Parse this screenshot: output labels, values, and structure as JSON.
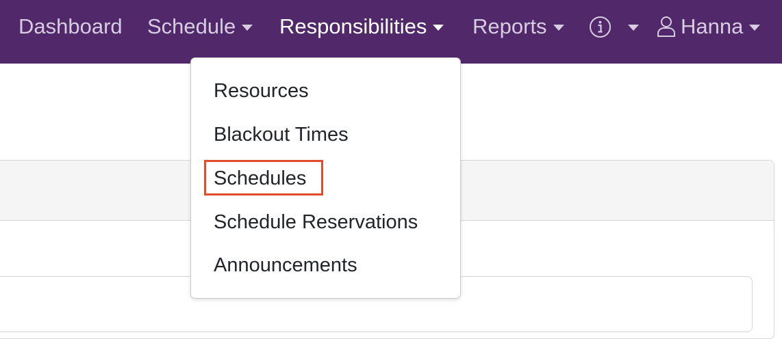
{
  "navbar": {
    "items": [
      {
        "label": "Dashboard"
      },
      {
        "label": "Schedule"
      },
      {
        "label": "Responsibilities"
      },
      {
        "label": "Reports"
      },
      {
        "label": ""
      },
      {
        "label": "Hanna"
      }
    ],
    "active": "Responsibilities",
    "background": "#51296b",
    "icons": {
      "info": "info-circle-icon",
      "user": "user-icon",
      "caret": "caret-down-icon"
    }
  },
  "dropdown": {
    "items": [
      {
        "label": "Resources"
      },
      {
        "label": "Blackout Times"
      },
      {
        "label": "Schedules"
      },
      {
        "label": "Schedule Reservations"
      },
      {
        "label": "Announcements"
      }
    ],
    "highlighted": "Schedules",
    "highlight_color": "#e34b2b"
  }
}
